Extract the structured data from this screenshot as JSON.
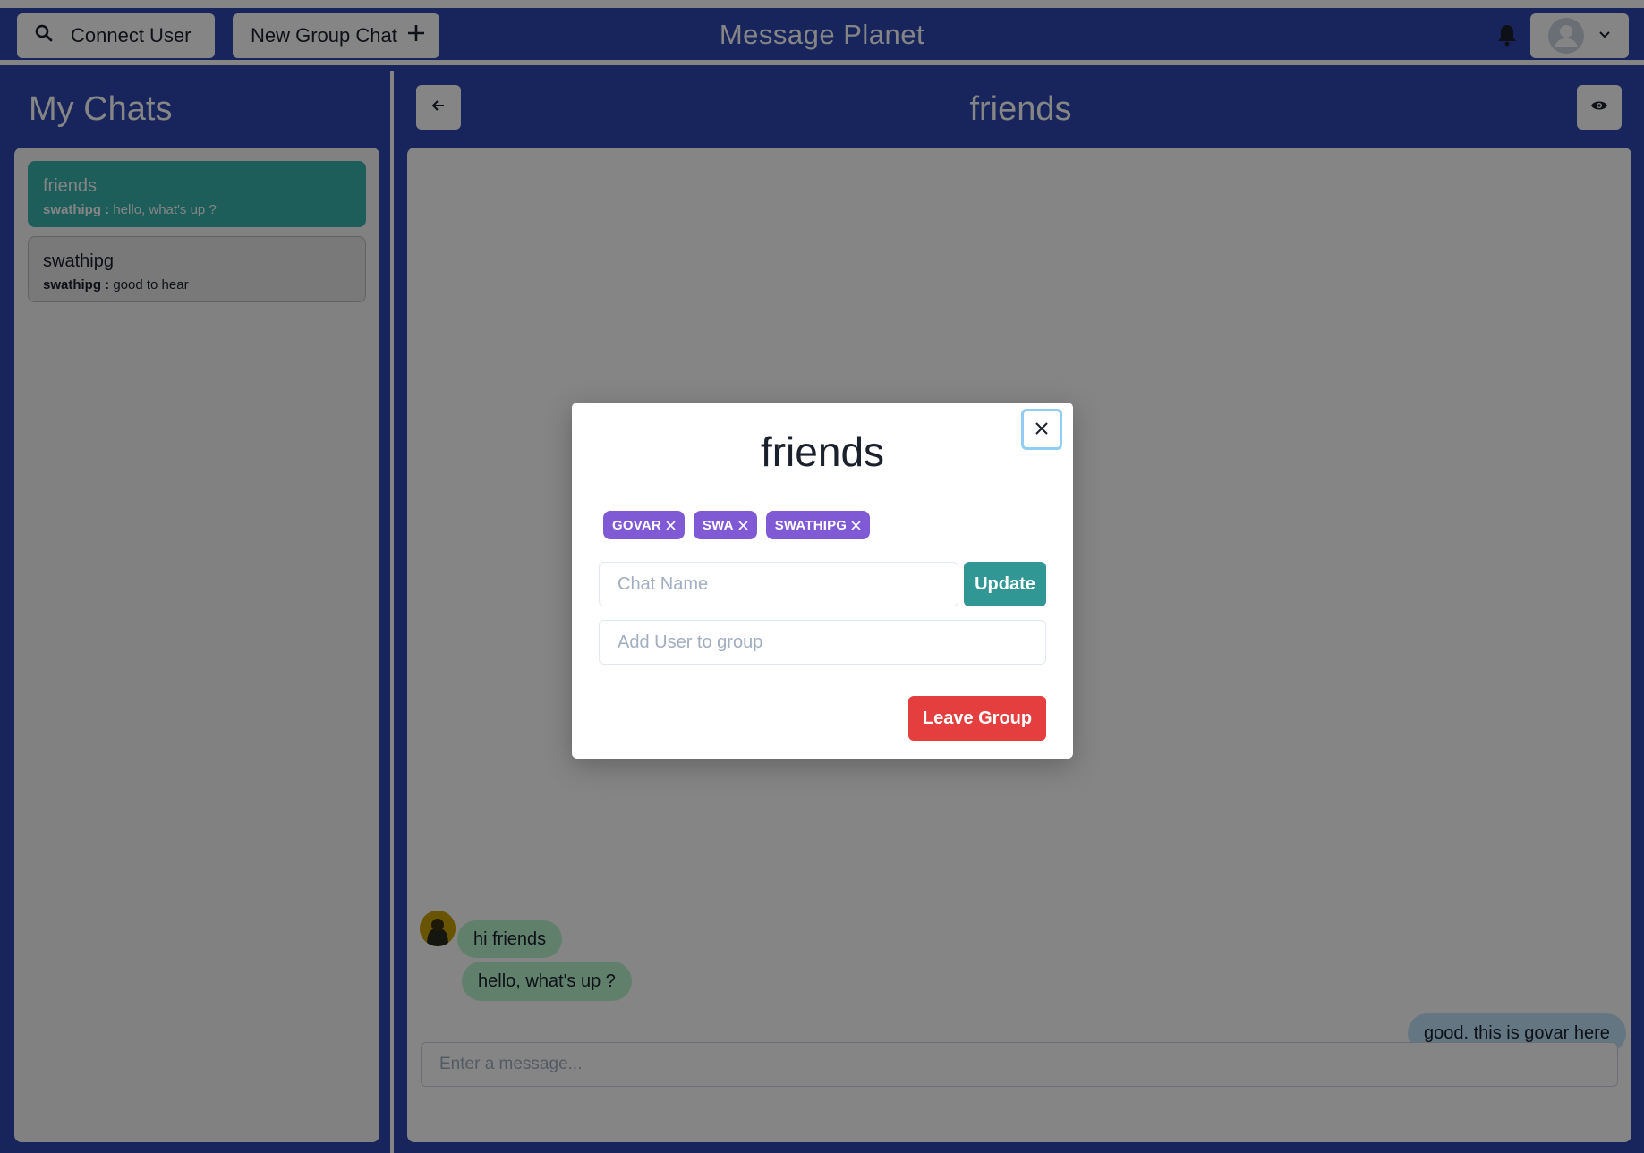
{
  "header": {
    "connect_user_label": "Connect User",
    "new_group_chat_label": "New Group Chat",
    "app_title": "Message Planet"
  },
  "sidebar": {
    "title": "My Chats",
    "chats": [
      {
        "name": "friends",
        "sender": "swathipg :",
        "preview": "hello, what's up ?",
        "active": true
      },
      {
        "name": "swathipg",
        "sender": "swathipg :",
        "preview": "good to hear",
        "active": false
      }
    ]
  },
  "chat": {
    "title": "friends",
    "messages": [
      {
        "text": "hi friends",
        "direction": "incoming"
      },
      {
        "text": "hello, what's up ?",
        "direction": "incoming"
      },
      {
        "text": "good. this is govar here",
        "direction": "outgoing"
      }
    ],
    "input_placeholder": "Enter a message..."
  },
  "modal": {
    "title": "friends",
    "members": [
      "GOVAR",
      "SWA",
      "SWATHIPG"
    ],
    "chat_name_placeholder": "Chat Name",
    "update_label": "Update",
    "add_user_placeholder": "Add User to group",
    "leave_label": "Leave Group"
  },
  "colors": {
    "accent_teal": "#319795",
    "badge_purple": "#805ad5",
    "danger_red": "#e53e3e",
    "brand_blue": "#2d48b0"
  },
  "icons": [
    "search-icon",
    "plus-icon",
    "bell-icon",
    "user-avatar-icon",
    "chevron-down-icon",
    "arrow-left-icon",
    "eye-icon",
    "close-icon"
  ]
}
